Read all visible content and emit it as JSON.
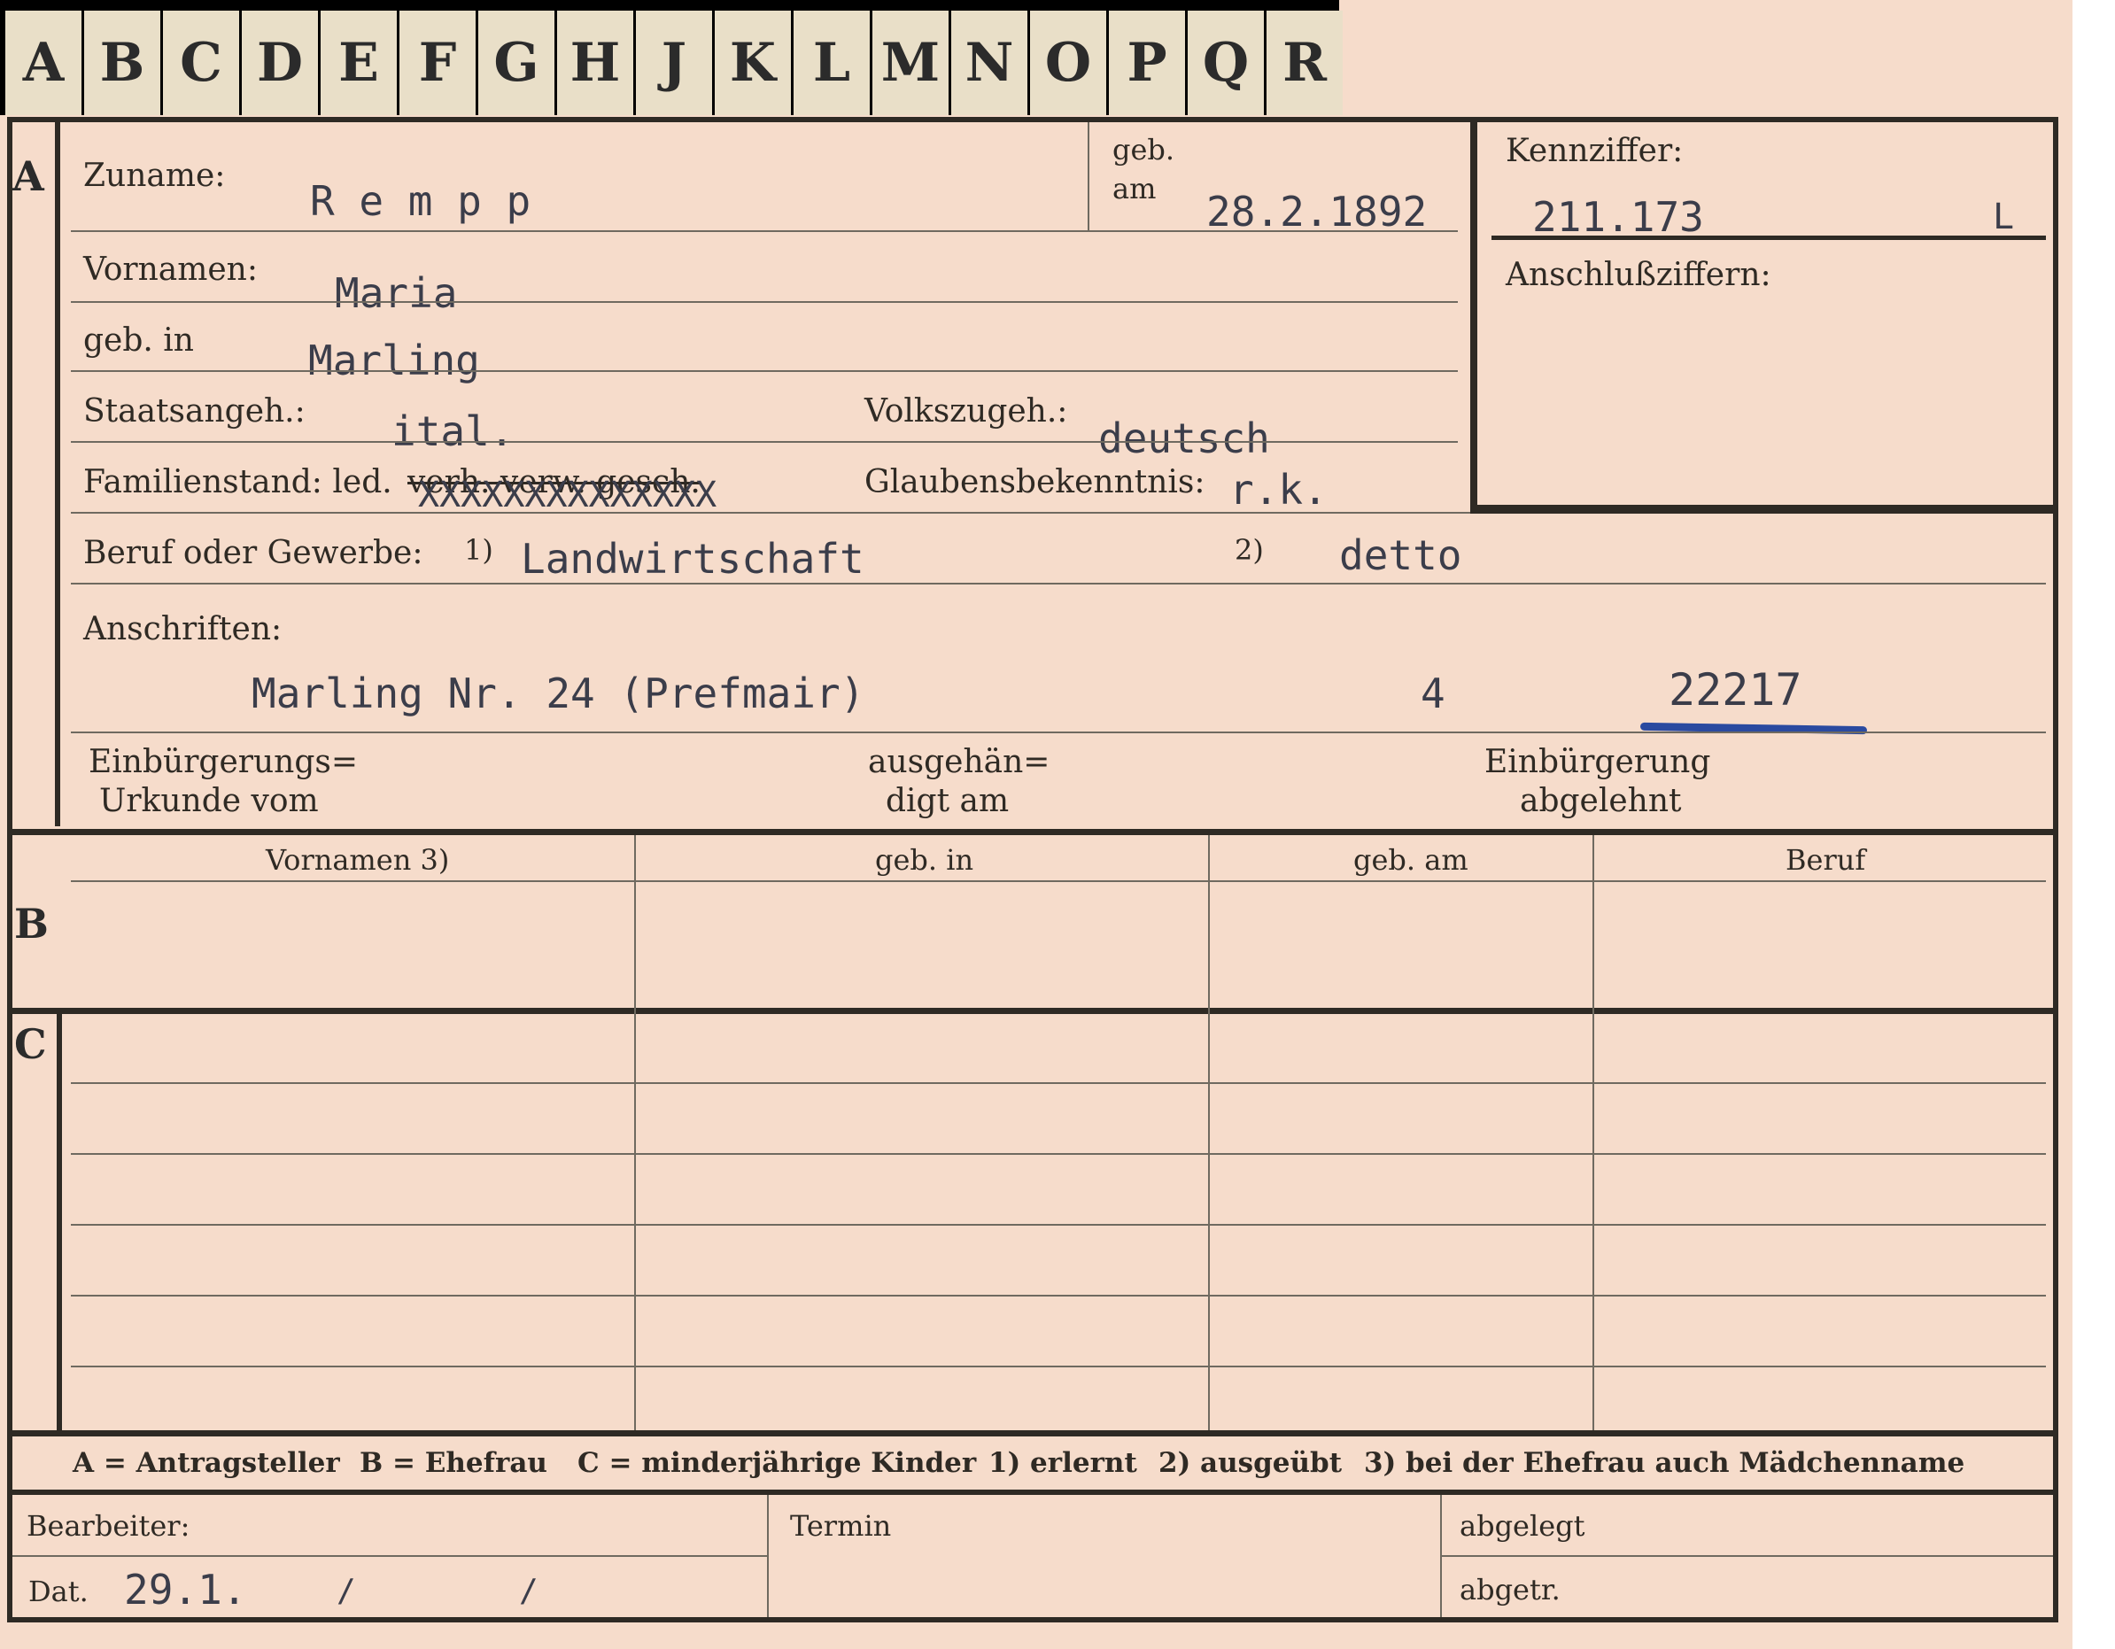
{
  "tabs": [
    "A",
    "B",
    "C",
    "D",
    "E",
    "F",
    "G",
    "H",
    "J",
    "K",
    "L",
    "M",
    "N",
    "O",
    "P",
    "Q",
    "R"
  ],
  "sections": {
    "a": "A",
    "b": "B",
    "c": "C"
  },
  "labels": {
    "zuname": "Zuname:",
    "geb_am_1": "geb.",
    "geb_am_2": "am",
    "kennziffer": "Kennziffer:",
    "anschlussziffern": "Anschlußziffern:",
    "vornamen": "Vornamen:",
    "geb_in": "geb. in",
    "staatsangeh": "Staatsangeh.:",
    "volkszugeh": "Volkszugeh.:",
    "familienstand": "Familienstand: led.",
    "familienstand_struck": "verh. verw. gesch.",
    "glaubensbekenntnis": "Glaubensbekenntnis:",
    "beruf": "Beruf oder Gewerbe:",
    "beruf_n1": "1)",
    "beruf_n2": "2)",
    "anschriften": "Anschriften:",
    "einb_urkunde_1": "Einbürgerungs=",
    "einb_urkunde_2": "Urkunde vom",
    "ausgehaendigt_1": "ausgehän=",
    "ausgehaendigt_2": "digt am",
    "einb_abgelehnt_1": "Einbürgerung",
    "einb_abgelehnt_2": "abgelehnt"
  },
  "values": {
    "zuname": "R e m p p",
    "geb_am": "28.2.1892",
    "kennziffer": "211.173",
    "kennziffer_suffix": "L",
    "vornamen": "Maria",
    "geb_in": "Marling",
    "staatsangeh": "ital.",
    "volkszugeh": "deutsch",
    "familienstand_overtype": "XXXXXXXXXXXXXX",
    "glaubensbekenntnis": "r.k.",
    "beruf_1": "Landwirtschaft",
    "beruf_2": "detto",
    "anschrift": "Marling Nr. 24 (Prefmair)",
    "anschrift_num": "4",
    "anschrift_code": "22217"
  },
  "table": {
    "headers": [
      "Vornamen 3)",
      "geb. in",
      "geb. am",
      "Beruf"
    ]
  },
  "footer": {
    "legend_a": "A = Antragsteller",
    "legend_b": "B = Ehefrau",
    "legend_c": "C = minderjährige Kinder",
    "legend_1": "1) erlernt",
    "legend_2": "2) ausgeübt",
    "legend_3": "3) bei der Ehefrau auch Mädchenname",
    "bearbeiter": "Bearbeiter:",
    "termin": "Termin",
    "abgelegt": "abgelegt",
    "dat": "Dat.",
    "dat_value": "29.1.",
    "dat_slash1": "/",
    "dat_slash2": "/",
    "abgetr": "abgetr."
  },
  "colors": {
    "card": "#f6dccb",
    "frame": "#2e2a24",
    "tab": "#e9dfc8",
    "typewriter": "#3b3d4a",
    "ink_blue": "#2a4aa0"
  }
}
